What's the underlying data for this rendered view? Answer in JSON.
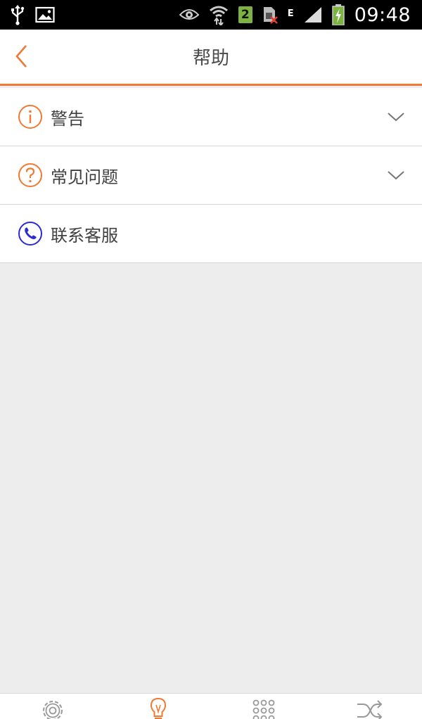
{
  "status_bar": {
    "time": "09:48",
    "sim_slot": "2",
    "network_type": "E",
    "icons": [
      "usb-icon",
      "image-icon",
      "eye-icon",
      "wifi-icon",
      "sim-icon",
      "signal-icon",
      "battery-charging-icon"
    ]
  },
  "header": {
    "title": "帮助",
    "back_icon": "chevron-left-icon"
  },
  "menu": {
    "items": [
      {
        "label": "警告",
        "icon": "info-circle-icon",
        "expandable": true
      },
      {
        "label": "常见问题",
        "icon": "question-circle-icon",
        "expandable": true
      },
      {
        "label": "联系客服",
        "icon": "phone-circle-icon",
        "expandable": false
      }
    ]
  },
  "tab_bar": {
    "tabs": [
      {
        "icon": "gear-icon",
        "active": false
      },
      {
        "icon": "lightbulb-icon",
        "active": true
      },
      {
        "icon": "grid-icon",
        "active": false
      },
      {
        "icon": "shuffle-icon",
        "active": false
      }
    ]
  },
  "colors": {
    "accent": "#f07a33",
    "phone_icon": "#2b2bd6",
    "background": "#ededed",
    "text": "#3f3f3f"
  }
}
